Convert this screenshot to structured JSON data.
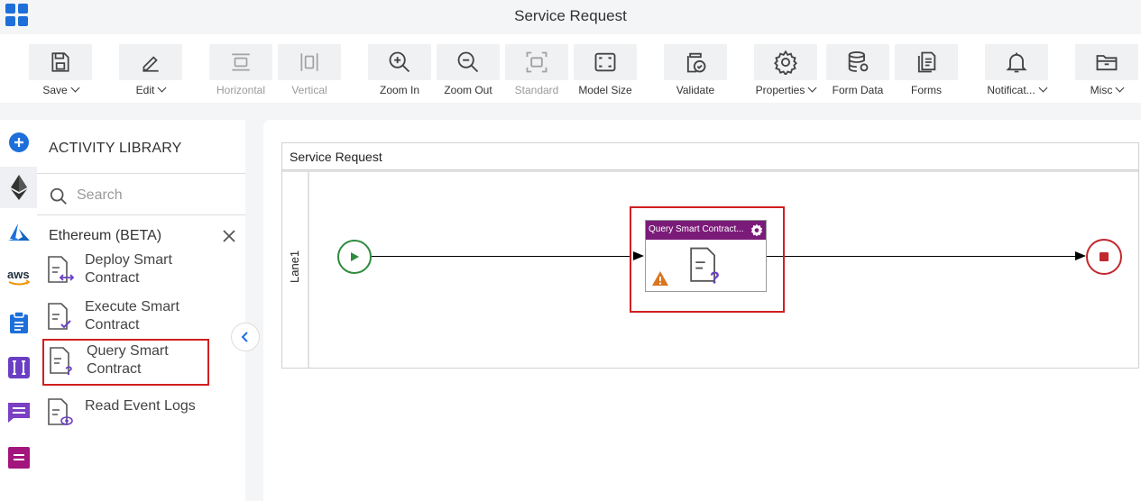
{
  "app": {
    "title": "Service Request"
  },
  "toolbar": {
    "items": [
      {
        "label": "Save",
        "icon": "save-icon",
        "dropdown": true
      },
      {
        "label": "Edit",
        "icon": "edit-icon",
        "dropdown": true
      },
      {
        "label": "Horizontal",
        "icon": "horizontal-align-icon",
        "disabled": true
      },
      {
        "label": "Vertical",
        "icon": "vertical-align-icon",
        "disabled": true
      },
      {
        "label": "Zoom In",
        "icon": "zoom-in-icon"
      },
      {
        "label": "Zoom Out",
        "icon": "zoom-out-icon"
      },
      {
        "label": "Standard",
        "icon": "standard-size-icon",
        "disabled": true
      },
      {
        "label": "Model Size",
        "icon": "model-size-icon"
      },
      {
        "label": "Validate",
        "icon": "validate-icon"
      },
      {
        "label": "Properties",
        "icon": "gear-icon",
        "dropdown": true
      },
      {
        "label": "Form Data",
        "icon": "database-icon"
      },
      {
        "label": "Forms",
        "icon": "forms-icon"
      },
      {
        "label": "Notificat...",
        "icon": "bell-icon",
        "dropdown": true
      },
      {
        "label": "Misc",
        "icon": "folder-icon",
        "dropdown": true
      }
    ]
  },
  "rail": {
    "items": [
      "add-icon",
      "ethereum-icon",
      "azure-icon",
      "aws-icon",
      "clipboard-icon",
      "integration-icon",
      "chat-icon",
      "form-icon"
    ]
  },
  "library": {
    "title": "ACTIVITY LIBRARY",
    "search_placeholder": "Search",
    "category": "Ethereum (BETA)",
    "activities": [
      {
        "line1": "Deploy Smart",
        "line2": "Contract"
      },
      {
        "line1": "Execute Smart",
        "line2": "Contract"
      },
      {
        "line1": "Query Smart",
        "line2": "Contract"
      },
      {
        "line1": "Read Event Logs",
        "line2": ""
      }
    ]
  },
  "canvas": {
    "pool_name": "Service Request",
    "lane_name": "Lane1",
    "task_name": "Query Smart Contract..."
  },
  "colors": {
    "accent": "#1e6fd9",
    "task_header": "#7b1b79",
    "start_event": "#2e8b3e",
    "end_event": "#c0282d",
    "selection": "#d01f1f",
    "warning": "#d9761f"
  }
}
